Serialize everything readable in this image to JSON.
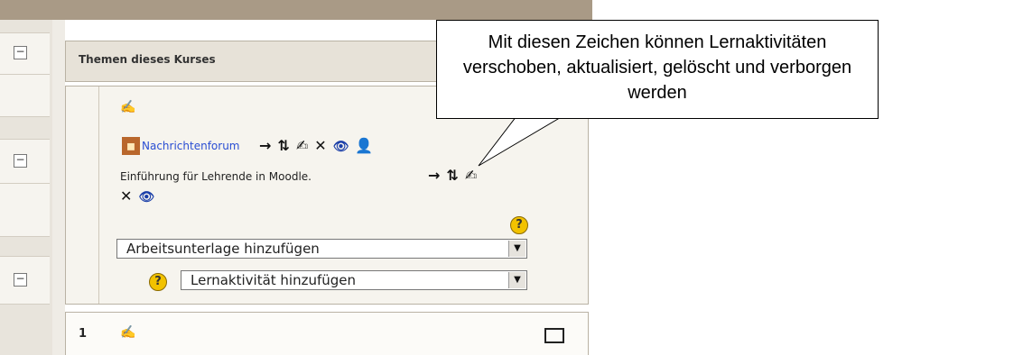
{
  "panel": {
    "title": "Themen dieses Kurses"
  },
  "section0": {
    "forum": {
      "label": "Nachrichtenforum"
    },
    "resource": {
      "description": "Einführung für Lehrende in Moodle."
    },
    "add_resource": {
      "selected": "Arbeitsunterlage hinzufügen"
    },
    "add_activity": {
      "selected": "Lernaktivität hinzufügen"
    }
  },
  "section1": {
    "number": "1"
  },
  "callout": {
    "text": "Mit diesen Zeichen können Lernaktivitäten verschoben, aktualisiert, gelöscht und verborgen werden"
  },
  "icons": {
    "move_right": "→",
    "move_updown": "⇅",
    "edit": "✍",
    "delete": "✕",
    "hide": "👁",
    "role": "👤",
    "collapse": "−",
    "help": "?",
    "dropdown": "▼"
  }
}
